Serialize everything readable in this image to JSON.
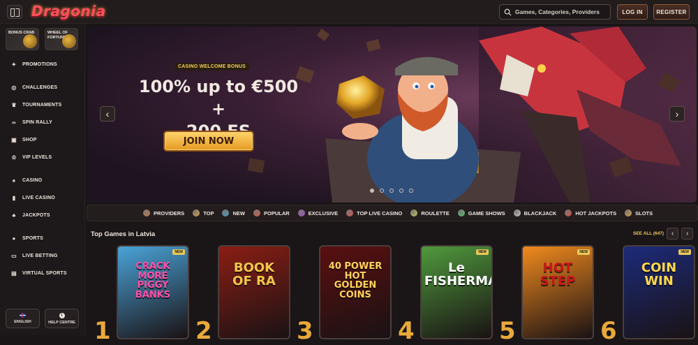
{
  "header": {
    "logo": "Dragonia",
    "search_placeholder": "Games, Categories, Providers",
    "login": "LOG IN",
    "register": "REGISTER"
  },
  "sidebar": {
    "tiles": [
      {
        "label": "BONUS CRAB"
      },
      {
        "label": "WHEEL OF FORTUNE"
      }
    ],
    "groups": [
      [
        {
          "label": "PROMOTIONS",
          "icon": "gift-icon"
        }
      ],
      [
        {
          "label": "CHALLENGES",
          "icon": "target-icon"
        },
        {
          "label": "TOURNAMENTS",
          "icon": "trophy-icon"
        },
        {
          "label": "SPIN RALLY",
          "icon": "infinity-icon"
        },
        {
          "label": "SHOP",
          "icon": "shop-icon"
        },
        {
          "label": "VIP LEVELS",
          "icon": "crown-icon"
        }
      ],
      [
        {
          "label": "CASINO",
          "icon": "cards-icon"
        },
        {
          "label": "LIVE CASINO",
          "icon": "live-icon"
        },
        {
          "label": "JACKPOTS",
          "icon": "clover-icon"
        }
      ],
      [
        {
          "label": "SPORTS",
          "icon": "ball-icon"
        },
        {
          "label": "LIVE BETTING",
          "icon": "tv-icon"
        },
        {
          "label": "VIRTUAL SPORTS",
          "icon": "monitor-icon"
        }
      ]
    ],
    "language": "ENGLISH",
    "help": "HELP CENTRE"
  },
  "hero": {
    "badge": "CASINO WELCOME BONUS",
    "title_line1": "100% up to €500 +",
    "title_line2": "200 FS",
    "cta": "JOIN NOW",
    "slides": 5,
    "active_slide": 1
  },
  "categories": [
    {
      "label": "PROVIDERS",
      "color": "#c9793a"
    },
    {
      "label": "TOP",
      "color": "#d9a23e"
    },
    {
      "label": "NEW",
      "color": "#3aa0c9"
    },
    {
      "label": "POPULAR",
      "color": "#e0583a"
    },
    {
      "label": "EXCLUSIVE",
      "color": "#a64ad0"
    },
    {
      "label": "TOP LIVE CASINO",
      "color": "#e04a4a"
    },
    {
      "label": "ROULETTE",
      "color": "#c9c94a"
    },
    {
      "label": "GAME SHOWS",
      "color": "#4ac96a"
    },
    {
      "label": "BLACKJACK",
      "color": "#d0d0d0"
    },
    {
      "label": "HOT JACKPOTS",
      "color": "#e0453a"
    },
    {
      "label": "SLOTS",
      "color": "#e0a23a"
    }
  ],
  "section": {
    "title": "Top Games in Latvia",
    "see_all": "SEE ALL (647)"
  },
  "games": [
    {
      "rank": "1",
      "title": "CRACK MORE PIGGY BANKS",
      "badge": "NEW",
      "bg": "#4aa3d8",
      "fg": "#ff4fa8"
    },
    {
      "rank": "2",
      "title": "BOOK OF RA",
      "badge": "",
      "bg": "#8a1e14",
      "fg": "#f3c64a"
    },
    {
      "rank": "3",
      "title": "40 POWER HOT GOLDEN COINS",
      "badge": "",
      "bg": "#5a0f0f",
      "fg": "#ffd35a"
    },
    {
      "rank": "4",
      "title": "Le FISHERMAN",
      "badge": "NEW",
      "bg": "#4f9a3c",
      "fg": "#ffffff"
    },
    {
      "rank": "5",
      "title": "HOT STEP",
      "badge": "NEW",
      "bg": "#f08a1e",
      "fg": "#c81818"
    },
    {
      "rank": "6",
      "title": "COIN WIN",
      "badge": "NEW",
      "bg": "#1c2b7a",
      "fg": "#ffd84a"
    }
  ]
}
